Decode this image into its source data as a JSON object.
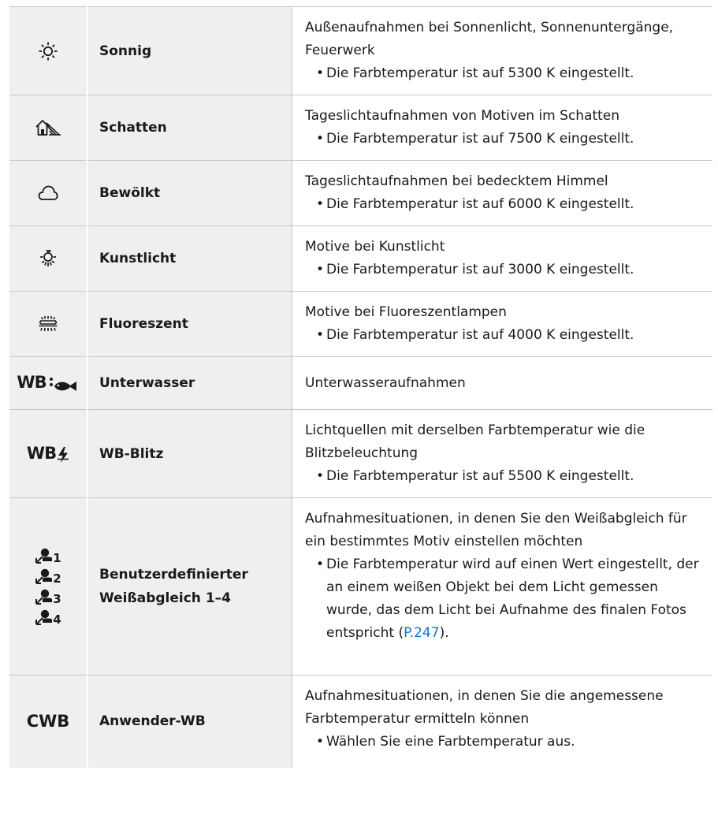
{
  "rows": [
    {
      "icon": "sun-icon",
      "name": "Sonnig",
      "desc": "Außenaufnahmen bei Sonnenlicht, Sonnenuntergänge, Feuerwerk",
      "bullet": "Die Farbtemperatur ist auf 5300 K eingestellt."
    },
    {
      "icon": "shade-icon",
      "name": "Schatten",
      "desc": "Tageslichtaufnahmen von Motiven im Schatten",
      "bullet": "Die Farbtemperatur ist auf 7500 K eingestellt."
    },
    {
      "icon": "cloud-icon",
      "name": "Bewölkt",
      "desc": "Tageslichtaufnahmen bei bedecktem Himmel",
      "bullet": "Die Farbtemperatur ist auf 6000 K eingestellt."
    },
    {
      "icon": "lightbulb-icon",
      "name": "Kunstlicht",
      "desc": "Motive bei Kunstlicht",
      "bullet": "Die Farbtemperatur ist auf 3000 K eingestellt."
    },
    {
      "icon": "fluorescent-icon",
      "name": "Fluoreszent",
      "desc": "Motive bei Fluoreszentlampen",
      "bullet": "Die Farbtemperatur ist auf 4000 K eingestellt."
    },
    {
      "icon_text": "WB",
      "icon": "underwater-fish-icon",
      "name": "Unterwasser",
      "desc": "Unterwasseraufnahmen"
    },
    {
      "icon_text": "WB",
      "icon": "flash-icon",
      "name": "WB-Blitz",
      "desc": "Lichtquellen mit derselben Farbtemperatur wie die Blitzbeleuchtung",
      "bullet": "Die Farbtemperatur ist auf 5500 K eingestellt."
    },
    {
      "icon": "custom-wb-icon",
      "custom_numbers": [
        "1",
        "2",
        "3",
        "4"
      ],
      "name": "Benutzerdefinierter Weißabgleich 1–4",
      "desc": "Aufnahmesituationen, in denen Sie den Weißabgleich für ein bestimmtes Motiv einstellen möchten",
      "bullet": "Die Farbtemperatur wird auf einen Wert eingestellt, der an einem weißen Objekt bei dem Licht gemessen wurde, das dem Licht bei Aufnahme des finalen Fotos entspricht (",
      "link": "P.247",
      "bullet_end": ")."
    },
    {
      "icon_text": "CWB",
      "name": "Anwender-WB",
      "desc": "Aufnahmesituationen, in denen Sie die angemessene Farbtemperatur ermitteln können",
      "bullet": "Wählen Sie eine Farbtemperatur aus."
    }
  ],
  "colors": {
    "cell_bg": "#efefef",
    "border": "#c8c8c8",
    "link": "#1473d2",
    "text": "#1a1a1a"
  }
}
